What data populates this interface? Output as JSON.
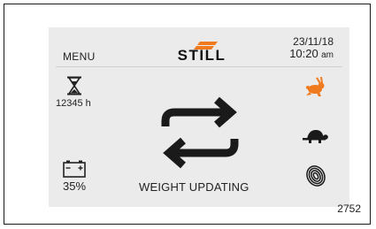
{
  "header": {
    "menu_label": "MENU",
    "brand": "STILL",
    "date": "23/11/18",
    "time": "10:20",
    "ampm": "am"
  },
  "status": {
    "operating_hours": "12345 h",
    "battery": "35%",
    "message": "WEIGHT UPDATING"
  },
  "icons": {
    "hours": "hourglass-icon",
    "battery": "battery-icon",
    "exchange": "swap-arrows-icon",
    "fast_mode": "rabbit-icon",
    "slow_mode": "turtle-icon",
    "identification": "fingerprint-icon"
  },
  "colors": {
    "accent": "#f07a1e",
    "screen": "#ebebeb",
    "text": "#222222"
  },
  "figure": {
    "number": "2752"
  }
}
